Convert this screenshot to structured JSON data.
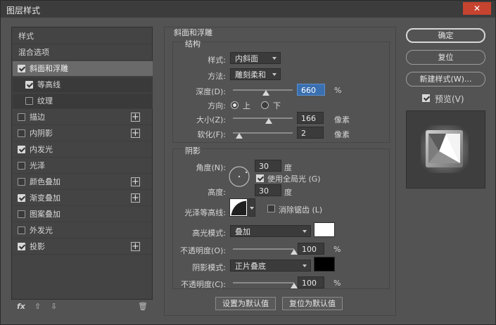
{
  "window": {
    "title": "图层样式",
    "close_glyph": "✕"
  },
  "left_panel": {
    "items": [
      {
        "label": "样式",
        "checkbox": false,
        "checked": false,
        "plus": false
      },
      {
        "label": "混合选项",
        "checkbox": false,
        "checked": false,
        "plus": false
      },
      {
        "label": "斜面和浮雕",
        "checkbox": true,
        "checked": true,
        "plus": false,
        "selected": true
      },
      {
        "label": "等高线",
        "checkbox": true,
        "checked": true,
        "plus": false,
        "sub": true
      },
      {
        "label": "纹理",
        "checkbox": true,
        "checked": false,
        "plus": false,
        "sub": true
      },
      {
        "label": "描边",
        "checkbox": true,
        "checked": false,
        "plus": true
      },
      {
        "label": "内阴影",
        "checkbox": true,
        "checked": false,
        "plus": true
      },
      {
        "label": "内发光",
        "checkbox": true,
        "checked": true,
        "plus": false
      },
      {
        "label": "光泽",
        "checkbox": true,
        "checked": false,
        "plus": false
      },
      {
        "label": "颜色叠加",
        "checkbox": true,
        "checked": false,
        "plus": true
      },
      {
        "label": "渐变叠加",
        "checkbox": true,
        "checked": true,
        "plus": true
      },
      {
        "label": "图案叠加",
        "checkbox": true,
        "checked": false,
        "plus": false
      },
      {
        "label": "外发光",
        "checkbox": true,
        "checked": false,
        "plus": false
      },
      {
        "label": "投影",
        "checkbox": true,
        "checked": true,
        "plus": true
      }
    ],
    "footer": {
      "fx": "fx",
      "up": "⇧",
      "down": "⇩",
      "trash": "🗑"
    }
  },
  "bevel": {
    "group_title": "斜面和浮雕",
    "structure": {
      "title": "结构",
      "style_label": "样式:",
      "style_value": "内斜面",
      "technique_label": "方法:",
      "technique_value": "雕刻柔和",
      "depth_label": "深度(D):",
      "depth_value": "660",
      "depth_unit": "%",
      "depth_slider_fraction": 0.55,
      "direction_label": "方向:",
      "direction_up": "上",
      "direction_down": "下",
      "direction_selected": "上",
      "size_label": "大小(Z):",
      "size_value": "166",
      "size_unit": "像素",
      "size_slider_fraction": 0.6,
      "soften_label": "软化(F):",
      "soften_value": "2",
      "soften_unit": "像素",
      "soften_slider_fraction": 0.1
    },
    "shading": {
      "title": "阴影",
      "angle_label": "角度(N):",
      "angle_value": "30",
      "angle_unit": "度",
      "global_light_label": "使用全局光 (G)",
      "global_light_checked": true,
      "altitude_label": "高度:",
      "altitude_value": "30",
      "altitude_unit": "度",
      "gloss_contour_label": "光泽等高线:",
      "antialias_label": "消除锯齿 (L)",
      "antialias_checked": false,
      "highlight_mode_label": "高光模式:",
      "highlight_mode_value": "叠加",
      "highlight_color": "#ffffff",
      "highlight_opacity_label": "不透明度(O):",
      "highlight_opacity_value": "100",
      "highlight_opacity_unit": "%",
      "shadow_mode_label": "阴影模式:",
      "shadow_mode_value": "正片叠底",
      "shadow_color": "#000000",
      "shadow_opacity_label": "不透明度(C):",
      "shadow_opacity_value": "100",
      "shadow_opacity_unit": "%"
    },
    "make_default": "设置为默认值",
    "reset_default": "复位为默认值"
  },
  "right": {
    "ok": "确定",
    "reset": "复位",
    "new_style": "新建样式(W)...",
    "preview_label": "预览(V)",
    "preview_checked": true
  }
}
